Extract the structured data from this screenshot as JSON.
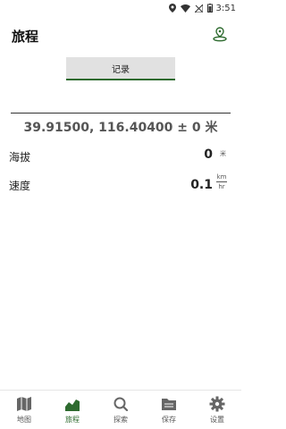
{
  "status_bar": {
    "time": "3:51"
  },
  "header": {
    "title": "旅程",
    "action_icon": "location-broadcast-icon"
  },
  "record_button": {
    "label": "记录"
  },
  "location": {
    "coordinates": "39.91500, 116.40400 ± 0 米"
  },
  "altitude": {
    "label": "海拔",
    "value": "0",
    "unit": "米"
  },
  "speed": {
    "label": "速度",
    "value": "0.1",
    "unit_top": "km",
    "unit_bottom": "hr"
  },
  "nav": {
    "items": [
      {
        "label": "地图",
        "icon": "map-icon"
      },
      {
        "label": "旅程",
        "icon": "chart-icon"
      },
      {
        "label": "探索",
        "icon": "search-icon"
      },
      {
        "label": "保存",
        "icon": "folder-icon"
      },
      {
        "label": "设置",
        "icon": "gear-icon"
      }
    ],
    "active_index": 1
  },
  "colors": {
    "accent": "#2e6b2f",
    "button_bg": "#e1e1e1"
  }
}
